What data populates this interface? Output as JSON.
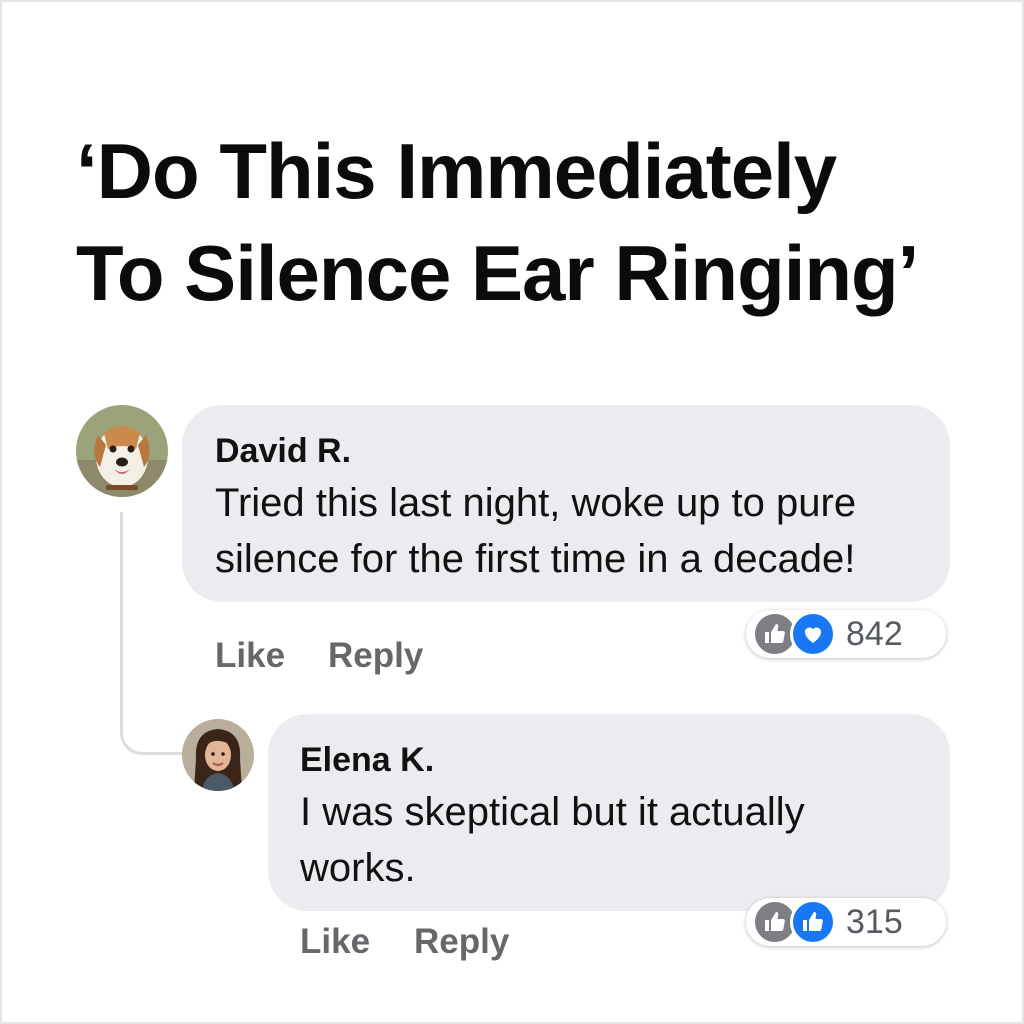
{
  "headline": {
    "line1": "‘Do This Immediately",
    "line2": "To Silence Ear Ringing’"
  },
  "comments": [
    {
      "author": "David R.",
      "avatar_icon": "dog-avatar-icon",
      "text_line1": "Tried this last night, woke up to pure",
      "text_line2": "silence for the first time in a decade!",
      "like_label": "Like",
      "reply_label": "Reply",
      "reaction_icons": [
        "like-reaction-icon",
        "love-reaction-icon"
      ],
      "reaction_count": "842"
    },
    {
      "author": "Elena K.",
      "avatar_icon": "woman-avatar-icon",
      "text_line1": "I was skeptical but it actually",
      "text_line2": "works.",
      "like_label": "Like",
      "reply_label": "Reply",
      "reaction_icons": [
        "like-reaction-icon",
        "like-reaction-icon"
      ],
      "reaction_count": "315"
    }
  ],
  "colors": {
    "bubble": "#ebecef",
    "action_text": "#65676b",
    "like_gray": "#7d7f84",
    "reaction_blue": "#1877f2",
    "thread_line": "#dcdde0"
  }
}
